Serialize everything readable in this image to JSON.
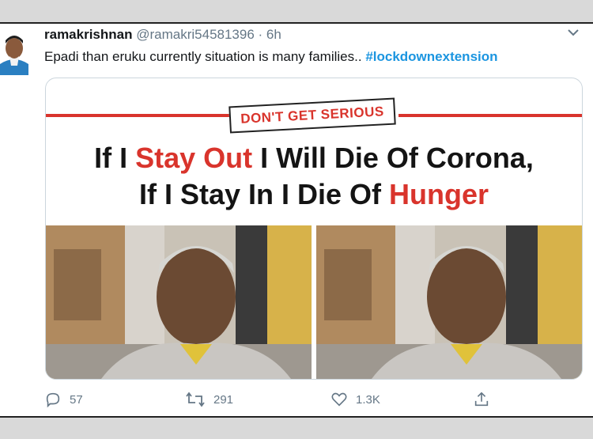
{
  "tweet": {
    "author_name": "ramakrishnan",
    "handle": "@ramakri54581396",
    "separator": " · ",
    "time": "6h",
    "text": "Epadi than eruku currently situation is many families.. ",
    "hashtag": "#lockdownextension"
  },
  "image": {
    "stamp": "DON'T GET SERIOUS",
    "line1_a": "If I ",
    "line1_b": "Stay Out",
    "line1_c": " I Will Die Of Corona,",
    "line2_a": "If I Stay In I Die Of ",
    "line2_b": "Hunger"
  },
  "actions": {
    "replies": "57",
    "retweets": "291",
    "likes": "1.3K"
  },
  "colors": {
    "accent": "#1b95e0",
    "headline_red": "#d9342c",
    "muted": "#657786"
  }
}
